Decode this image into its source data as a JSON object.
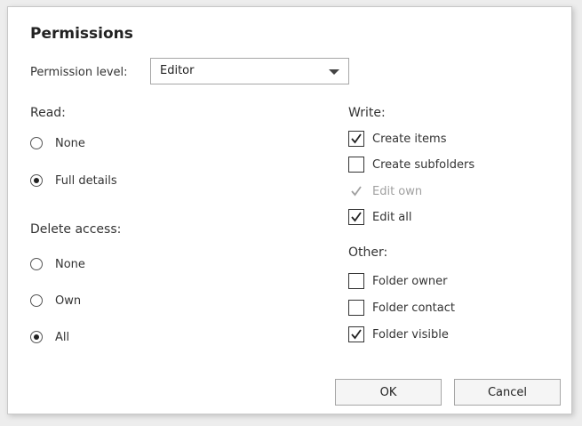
{
  "dialog": {
    "title": "Permissions",
    "permission_level_label": "Permission level:",
    "permission_level_value": "Editor"
  },
  "read": {
    "label": "Read:",
    "options": [
      {
        "label": "None",
        "selected": false
      },
      {
        "label": "Full details",
        "selected": true
      }
    ]
  },
  "delete_access": {
    "label": "Delete access:",
    "options": [
      {
        "label": "None",
        "selected": false
      },
      {
        "label": "Own",
        "selected": false
      },
      {
        "label": "All",
        "selected": true
      }
    ]
  },
  "write": {
    "label": "Write:",
    "items": [
      {
        "label": "Create items",
        "checked": true,
        "disabled": false
      },
      {
        "label": "Create subfolders",
        "checked": false,
        "disabled": false
      },
      {
        "label": "Edit own",
        "checked": true,
        "disabled": true
      },
      {
        "label": "Edit all",
        "checked": true,
        "disabled": false
      }
    ]
  },
  "other": {
    "label": "Other:",
    "items": [
      {
        "label": "Folder owner",
        "checked": false,
        "disabled": false
      },
      {
        "label": "Folder contact",
        "checked": false,
        "disabled": false
      },
      {
        "label": "Folder visible",
        "checked": true,
        "disabled": false
      }
    ]
  },
  "buttons": {
    "ok": "OK",
    "cancel": "Cancel"
  },
  "colors": {
    "check_enabled": "#222222",
    "check_disabled": "#a0a0a0"
  }
}
